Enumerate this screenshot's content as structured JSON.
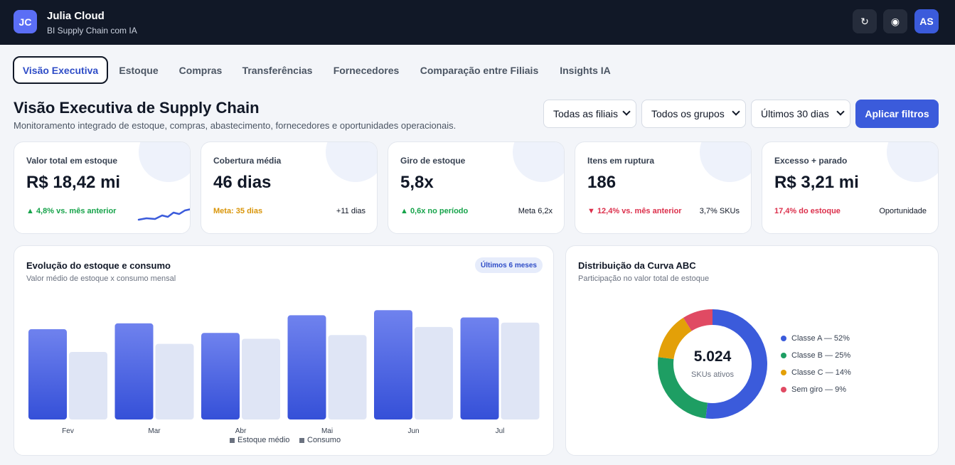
{
  "header": {
    "logo": "JC",
    "app_name": "Julia Cloud",
    "app_subtitle": "BI Supply Chain com IA",
    "refresh_glyph": "↻",
    "theme_glyph": "◉",
    "avatar": "AS",
    "icons": [
      "refresh-icon",
      "theme-toggle-icon"
    ]
  },
  "tabs": [
    {
      "label": "Visão Executiva",
      "active": true
    },
    {
      "label": "Estoque",
      "active": false
    },
    {
      "label": "Compras",
      "active": false
    },
    {
      "label": "Transferências",
      "active": false
    },
    {
      "label": "Fornecedores",
      "active": false
    },
    {
      "label": "Comparação entre Filiais",
      "active": false
    },
    {
      "label": "Insights IA",
      "active": false
    }
  ],
  "page": {
    "title": "Visão Executiva de Supply Chain",
    "subtitle": "Monitoramento integrado de estoque, compras, abastecimento, fornecedores e oportunidades operacionais."
  },
  "filters": {
    "branch": "Todas as filiais",
    "group": "Todos os grupos",
    "period": "Últimos 30 dias",
    "apply_label": "Aplicar filtros"
  },
  "kpis": [
    {
      "label": "Valor total em estoque",
      "value": "R$ 18,42 mi",
      "delta": "▲ 4,8% vs. mês anterior",
      "side": ""
    },
    {
      "label": "Cobertura média",
      "value": "46 dias",
      "delta": "Meta: 35 dias",
      "side": "+11 dias"
    },
    {
      "label": "Giro de estoque",
      "value": "5,8x",
      "delta": "▲ 0,6x no período",
      "side": "Meta 6,2x"
    },
    {
      "label": "Itens em ruptura",
      "value": "186",
      "delta": "▼ 12,4% vs. mês anterior",
      "side": "3,7% SKUs"
    },
    {
      "label": "Excesso + parado",
      "value": "R$ 3,21 mi",
      "delta": "17,4% do estoque",
      "side": "Oportunidade"
    }
  ],
  "colors": {
    "accent": "#3b5bdb",
    "positive": "#16a34a",
    "negative": "#dc2f4b",
    "warning": "#d99509"
  },
  "stock_panel": {
    "title": "Evolução do estoque e consumo",
    "subtitle": "Valor médio de estoque x consumo mensal",
    "badge": "Últimos 6 meses"
  },
  "abc_panel": {
    "title": "Distribuição da Curva ABC",
    "subtitle": "Participação no valor total de estoque",
    "center_value": "5.024",
    "center_label": "SKUs ativos",
    "legend": [
      "Classe A — 52%",
      "Classe B — 25%",
      "Classe C — 14%",
      "Sem giro — 9%"
    ]
  },
  "chart_data": [
    {
      "type": "bar",
      "categories": [
        "Fev",
        "Mar",
        "Abr",
        "Mai",
        "Jun",
        "Jul"
      ],
      "series": [
        {
          "name": "Estoque médio",
          "values": [
            123,
            131,
            118,
            142,
            149,
            139
          ],
          "color": "#4a63e6"
        },
        {
          "name": "Consumo",
          "values": [
            92,
            103,
            110,
            115,
            126,
            132
          ],
          "color": "#dfe5f5"
        }
      ],
      "ylim": [
        0,
        155
      ],
      "grid": false,
      "legend": "bottom-center"
    },
    {
      "type": "pie",
      "categories": [
        "Classe A",
        "Classe B",
        "Classe C",
        "Sem giro"
      ],
      "values": [
        52,
        25,
        14,
        9
      ],
      "colors": [
        "#3b5bdb",
        "#1e9e63",
        "#e3a008",
        "#e04a63"
      ],
      "legend": "right"
    }
  ]
}
